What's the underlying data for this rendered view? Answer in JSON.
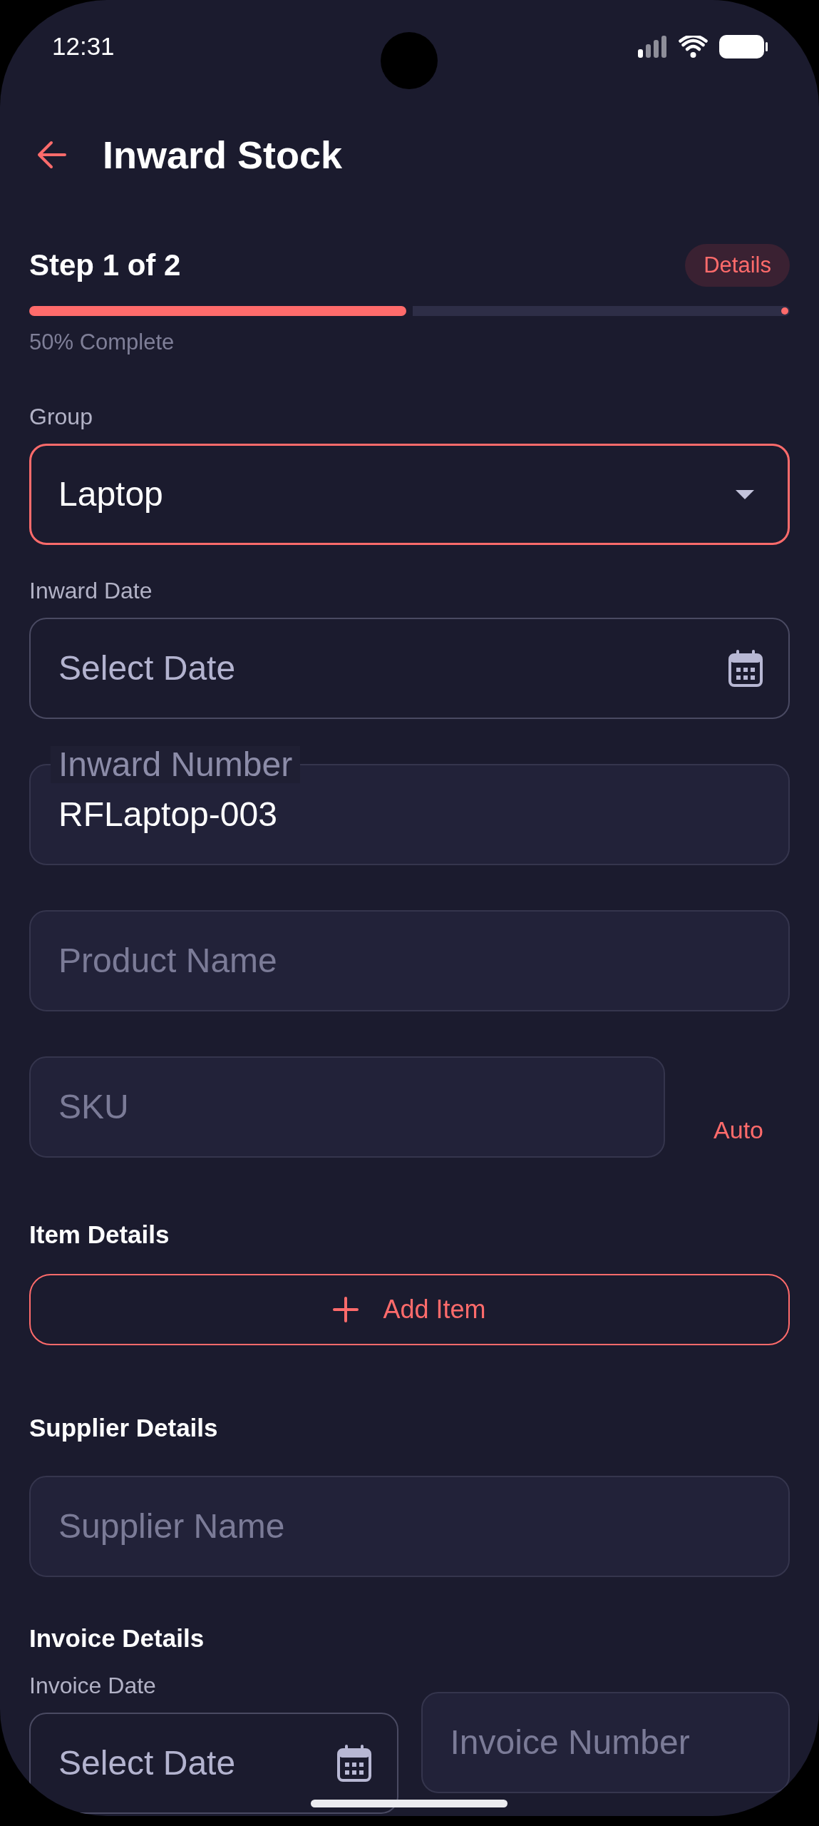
{
  "status_bar": {
    "time": "12:31"
  },
  "header": {
    "title": "Inward Stock"
  },
  "progress": {
    "step": "Step 1 of 2",
    "badge": "Details",
    "level": 0.5,
    "caption": "50% Complete"
  },
  "fields": [
    {
      "kind": "select",
      "label": "Group",
      "value": "Laptop",
      "focused": true
    },
    {
      "kind": "date",
      "label": "Inward Date",
      "placeholder": "Select Date",
      "focused": false
    },
    {
      "kind": "text",
      "floating_label": "Inward Number",
      "value": "RFLaptop-003",
      "focused": false
    },
    {
      "kind": "text",
      "placeholder": "Product Name",
      "focused": false
    },
    {
      "kind": "text",
      "placeholder": "SKU",
      "action": "Auto",
      "focused": false
    }
  ],
  "sections": [
    {
      "heading": "Item Details",
      "button": "Add Item"
    },
    {
      "heading": "Supplier Details",
      "fields": [
        {
          "kind": "text",
          "placeholder": "Supplier Name",
          "focused": false
        }
      ]
    },
    {
      "heading": "Invoice Details",
      "fields": [
        {
          "kind": "date",
          "label": "Invoice Date",
          "placeholder": "Select Date",
          "focused": false
        },
        {
          "kind": "text",
          "placeholder": "Invoice Number",
          "focused": false
        }
      ]
    }
  ]
}
